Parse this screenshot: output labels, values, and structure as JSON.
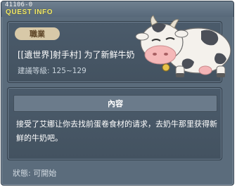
{
  "window": {
    "quest_id": "41106-0",
    "title": "QUEST INFO"
  },
  "quest": {
    "category": "職業",
    "name": "[[遺世界]射手村] 为了新鲜牛奶",
    "level_text": "建議等級: 125~129"
  },
  "content": {
    "header": "內容",
    "description": "接受了艾娜让你去找前蛋卷食材的请求，去奶牛那里获得新鲜的牛奶吧。"
  },
  "status": {
    "text": "狀態: 可開始"
  },
  "icons": {
    "cow": "cow-illustration-icon"
  }
}
